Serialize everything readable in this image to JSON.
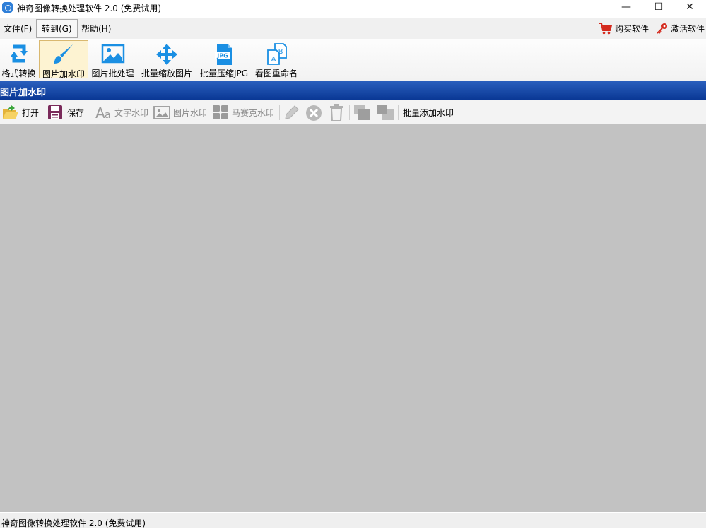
{
  "window": {
    "title": "神奇图像转换处理软件 2.0 (免费试用)",
    "controls": {
      "minimize": "—",
      "maximize": "☐",
      "close": "✕"
    }
  },
  "menubar": {
    "items": [
      {
        "label": "文件(F)"
      },
      {
        "label": "转到(G)"
      },
      {
        "label": "帮助(H)"
      }
    ],
    "buy_label": "购买软件",
    "activate_label": "激活软件"
  },
  "ribbon": {
    "buttons": [
      {
        "label": "格式转换",
        "icon": "convert-arrows-icon"
      },
      {
        "label": "图片加水印",
        "icon": "brush-icon",
        "selected": true
      },
      {
        "label": "图片批处理",
        "icon": "image-icon"
      },
      {
        "label": "批量缩放图片",
        "icon": "move-arrows-icon"
      },
      {
        "label": "批量压缩JPG",
        "icon": "jpg-file-icon"
      },
      {
        "label": "看图重命名",
        "icon": "rename-files-icon"
      }
    ]
  },
  "section": {
    "title": "图片加水印"
  },
  "toolbar": {
    "open_label": "打开",
    "save_label": "保存",
    "text_watermark_label": "文字水印",
    "image_watermark_label": "图片水印",
    "mosaic_watermark_label": "马赛克水印",
    "batch_add_label": "批量添加水印"
  },
  "statusbar": {
    "text": "神奇图像转换处理软件 2.0 (免费试用)"
  },
  "colors": {
    "section_header": "#0a3895",
    "canvas": "#c2c2c2",
    "accent_blue": "#1a8fe3",
    "cart_red": "#d42a1e"
  }
}
